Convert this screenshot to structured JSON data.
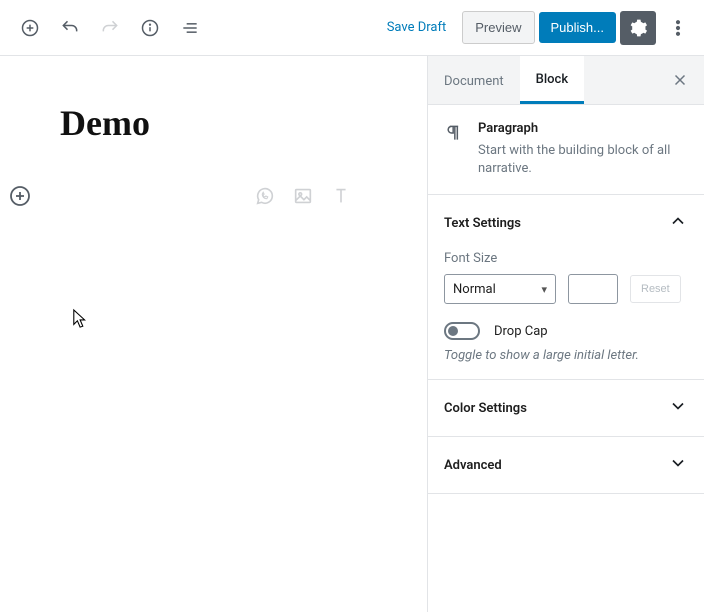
{
  "toolbar": {
    "save_draft": "Save Draft",
    "preview": "Preview",
    "publish": "Publish..."
  },
  "editor": {
    "title": "Demo"
  },
  "sidebar": {
    "tabs": {
      "document": "Document",
      "block": "Block"
    },
    "block_type": {
      "name": "Paragraph",
      "desc": "Start with the building block of all narrative."
    },
    "panels": {
      "text_settings": {
        "title": "Text Settings",
        "font_size_label": "Font Size",
        "font_size_value": "Normal",
        "reset": "Reset",
        "drop_cap_label": "Drop Cap",
        "drop_cap_help": "Toggle to show a large initial letter."
      },
      "color_settings": {
        "title": "Color Settings"
      },
      "advanced": {
        "title": "Advanced"
      }
    }
  }
}
